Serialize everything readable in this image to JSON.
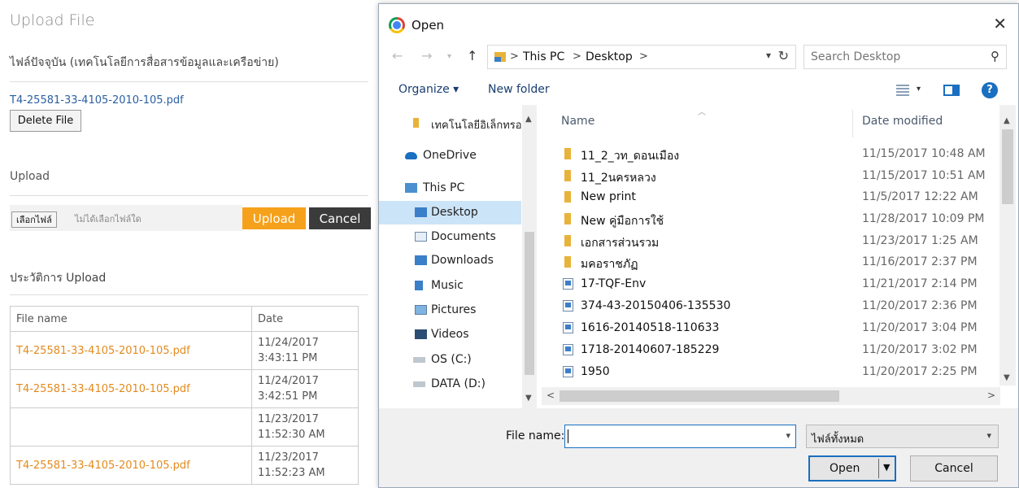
{
  "web": {
    "title": "Upload File",
    "current_label": "ไฟล์ปัจจุบัน (เทคโนโลยีการสื่อสารข้อมูลและเครือข่าย)",
    "current_file": "T4-25581-33-4105-2010-105.pdf",
    "delete_label": "Delete File",
    "upload_label": "Upload",
    "choose_label": "เลือกไฟล์",
    "no_file_text": "ไม่ได้เลือกไฟล์ใด",
    "upload_button": "Upload",
    "cancel_button": "Cancel",
    "history_label": "ประวัติการ Upload",
    "table": {
      "headers": [
        "File name",
        "Date"
      ],
      "rows": [
        {
          "file": "T4-25581-33-4105-2010-105.pdf",
          "date": "11/24/2017",
          "time": "3:43:11 PM"
        },
        {
          "file": "T4-25581-33-4105-2010-105.pdf",
          "date": "11/24/2017",
          "time": "3:42:51 PM"
        },
        {
          "file": "",
          "date": "11/23/2017",
          "time": "11:52:30 AM"
        },
        {
          "file": "T4-25581-33-4105-2010-105.pdf",
          "date": "11/23/2017",
          "time": "11:52:23 AM"
        }
      ]
    }
  },
  "dialog": {
    "title": "Open",
    "close": "✕",
    "address": [
      "This PC",
      "Desktop"
    ],
    "search_placeholder": "Search Desktop",
    "organize": "Organize ▾",
    "new_folder": "New folder",
    "help": "?",
    "nav": [
      {
        "label": "เทคโนโลยีอิเล็กทรอนิ",
        "icon": "folder"
      },
      {
        "label": "OneDrive",
        "icon": "cloud"
      },
      {
        "label": "This PC",
        "icon": "pc"
      },
      {
        "label": "Desktop",
        "icon": "desktop",
        "selected": true
      },
      {
        "label": "Documents",
        "icon": "documents"
      },
      {
        "label": "Downloads",
        "icon": "downloads"
      },
      {
        "label": "Music",
        "icon": "music"
      },
      {
        "label": "Pictures",
        "icon": "pictures"
      },
      {
        "label": "Videos",
        "icon": "videos"
      },
      {
        "label": "OS (C:)",
        "icon": "drive"
      },
      {
        "label": "DATA (D:)",
        "icon": "drive"
      }
    ],
    "columns": {
      "name": "Name",
      "date": "Date modified"
    },
    "files": [
      {
        "name": "11_2_วท_ดอนเมือง",
        "date": "11/15/2017 10:48 AM",
        "type": "folder"
      },
      {
        "name": "11_2นครหลวง",
        "date": "11/15/2017 10:51 AM",
        "type": "folder"
      },
      {
        "name": "New print",
        "date": "11/5/2017 12:22 AM",
        "type": "folder"
      },
      {
        "name": "New คู่มือการใช้",
        "date": "11/28/2017 10:09 PM",
        "type": "folder"
      },
      {
        "name": "เอกสารส่วนรวม",
        "date": "11/23/2017 1:25 AM",
        "type": "folder"
      },
      {
        "name": "มคอราชภัฏ",
        "date": "11/16/2017 2:37 PM",
        "type": "folder"
      },
      {
        "name": "17-TQF-Env",
        "date": "11/21/2017 2:14 PM",
        "type": "pdf"
      },
      {
        "name": "374-43-20150406-135530",
        "date": "11/20/2017 2:36 PM",
        "type": "pdf"
      },
      {
        "name": "1616-20140518-110633",
        "date": "11/20/2017 3:04 PM",
        "type": "pdf"
      },
      {
        "name": "1718-20140607-185229",
        "date": "11/20/2017 3:02 PM",
        "type": "pdf"
      },
      {
        "name": "1950",
        "date": "11/20/2017 2:25 PM",
        "type": "pdf"
      }
    ],
    "file_name_label": "File name:",
    "file_name_value": "",
    "file_type": "ไฟล์ทั้งหมด",
    "open_button": "Open",
    "cancel_button": "Cancel"
  }
}
